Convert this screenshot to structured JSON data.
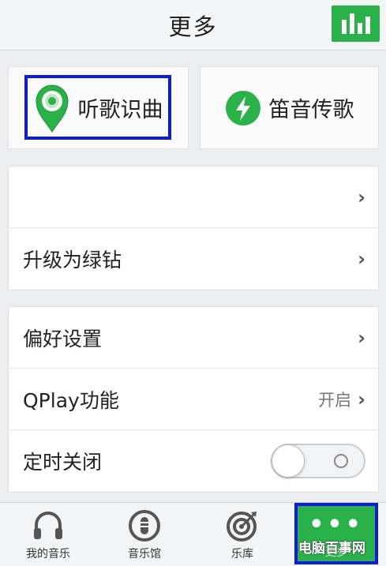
{
  "header": {
    "title": "更多"
  },
  "features": [
    {
      "label": "听歌识曲",
      "icon": "location-pin-icon"
    },
    {
      "label": "笛音传歌",
      "icon": "lightning-bolt-icon"
    }
  ],
  "group1": {
    "rows": [
      {
        "label": ""
      },
      {
        "label": "升级为绿钻"
      }
    ]
  },
  "group2": {
    "rows": [
      {
        "label": "偏好设置"
      },
      {
        "label": "QPlay功能",
        "value": "开启"
      },
      {
        "label": "定时关闭",
        "toggle_on": false
      }
    ]
  },
  "tabbar": {
    "tabs": [
      {
        "label": "我的音乐",
        "icon": "headphones-icon"
      },
      {
        "label": "音乐馆",
        "icon": "music-hall-icon"
      },
      {
        "label": "乐库",
        "icon": "target-icon"
      },
      {
        "label": "更多",
        "icon": "more-dots-icon"
      }
    ]
  },
  "watermark": "电脑百事网",
  "colors": {
    "accent": "#2bb14a",
    "highlight": "#0b1ce0"
  }
}
